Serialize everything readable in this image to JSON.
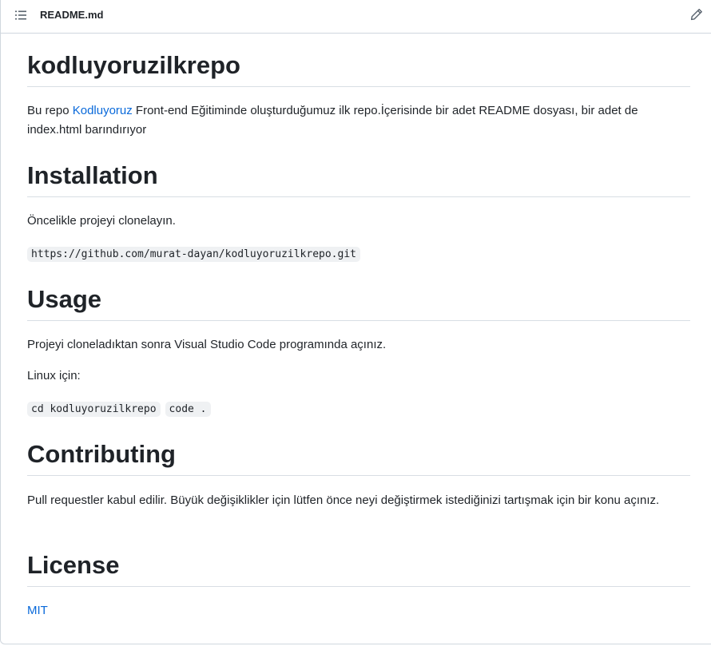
{
  "header": {
    "file_name": "README.md",
    "outline_icon": "list-unordered-icon",
    "edit_icon": "pencil-icon"
  },
  "readme": {
    "title": "kodluyoruzilkrepo",
    "intro": {
      "before_link": "Bu repo ",
      "link_text": "Kodluyoruz",
      "after_link": " Front-end Eğitiminde oluşturduğumuz ilk repo.İçerisinde bir adet README dosyası, bir adet de index.html barındırıyor"
    },
    "installation": {
      "heading": "Installation",
      "text": "Öncelikle projeyi clonelayın.",
      "code": "https://github.com/murat-dayan/kodluyoruzilkrepo.git"
    },
    "usage": {
      "heading": "Usage",
      "text": "Projeyi cloneladıktan sonra Visual Studio Code programında açınız.",
      "linux_label": "Linux için:",
      "code_1": "cd kodluyoruzilkrepo",
      "code_2": "code ."
    },
    "contributing": {
      "heading": "Contributing",
      "text": "Pull requestler kabul edilir. Büyük değişiklikler için lütfen önce neyi değiştirmek istediğinizi tartışmak için bir konu açınız."
    },
    "license": {
      "heading": "License",
      "link_text": "MIT"
    }
  },
  "colors": {
    "link": "#0969da",
    "text": "#1f2328",
    "border": "#d0d7de",
    "code_bg": "#eff1f3"
  }
}
